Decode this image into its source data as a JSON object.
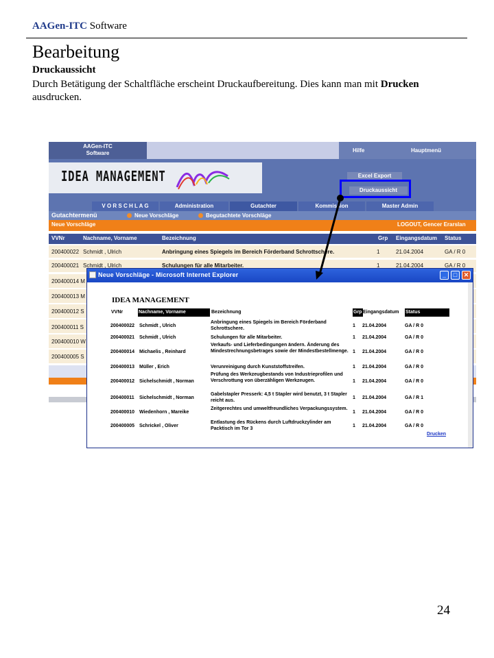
{
  "doc": {
    "header_brand": "AAGen-ITC",
    "header_rest": " Software",
    "title": "Bearbeitung",
    "subtitle": "Druckaussicht",
    "text_part1": "Durch Betätigung der Schaltfläche erscheint Druckaufbereitung. Dies kann man mit ",
    "text_bold": "Drucken",
    "text_part2": " ausdrucken.",
    "page_number": "24"
  },
  "app": {
    "logo_line1": "AAGen-ITC",
    "logo_line2": "Software",
    "help": "Hilfe",
    "main_menu": "Hauptmenü",
    "idea_logo": "IDEA MANAGEMENT",
    "excel_export": "Excel Export",
    "print_preview": "Druckaussicht",
    "nav": [
      "V O R S C H L A G",
      "Administration",
      "Gutachter",
      "Kommission",
      "Master Admin"
    ],
    "subnav_title": "Gutachtermenü",
    "subnav_links": [
      "Neue Vorschläge",
      "Begutachtete Vorschläge"
    ],
    "section_title": "Neue Vorschläge",
    "logout": "LOGOUT, Gencer Erarslan",
    "columns": [
      "VVNr",
      "Nachname, Vorname",
      "Bezeichnung",
      "Grp",
      "Eingangsdatum",
      "Status"
    ],
    "rows": [
      {
        "vvnr": "200400022",
        "name": "Schmidt , Ulrich",
        "desc": "Anbringung eines Spiegels im Bereich Förderband Schrottschere.",
        "grp": "1",
        "date": "21.04.2004",
        "status": "GA / R 0"
      },
      {
        "vvnr": "200400021",
        "name": "Schmidt , Ulrich",
        "desc": "Schulungen für alle Mitarbeiter.",
        "grp": "1",
        "date": "21.04.2004",
        "status": "GA / R 0"
      }
    ],
    "partial_rows": [
      "200400014 M",
      "200400013 M",
      "200400012 S",
      "200400011 S",
      "200400010 W",
      "200400005 S"
    ]
  },
  "popup": {
    "title": "Neue Vorschläge - Microsoft Internet Explorer",
    "heading": "IDEA MANAGEMENT",
    "columns": [
      "VVNr",
      "Nachname, Vorname",
      "Bezeichnung",
      "Grp",
      "Eingangsdatum",
      "Status"
    ],
    "rows": [
      {
        "vvnr": "200400022",
        "name": "Schmidt , Ulrich",
        "desc": "Anbringung eines Spiegels im Bereich Förderband Schrottschere.",
        "grp": "1",
        "date": "21.04.2004",
        "status": "GA / R 0"
      },
      {
        "vvnr": "200400021",
        "name": "Schmidt , Ulrich",
        "desc": "Schulungen für alle Mitarbeiter.",
        "grp": "1",
        "date": "21.04.2004",
        "status": "GA / R 0"
      },
      {
        "vvnr": "200400014",
        "name": "Michaelis , Reinhard",
        "desc": "Verkaufs- und Lieferbedingungen ändern. Änderung des Mindestrechnungsbetrages sowie der Mindestbestellmenge.",
        "grp": "1",
        "date": "21.04.2004",
        "status": "GA / R 0"
      },
      {
        "vvnr": "200400013",
        "name": "Müller , Erich",
        "desc": "Verunreinigung durch Kunststoffstreifen.",
        "grp": "1",
        "date": "21.04.2004",
        "status": "GA / R 0"
      },
      {
        "vvnr": "200400012",
        "name": "Sichelschmidt , Norman",
        "desc": "Prüfung des Werkzeugbestands von Industrieprofilen und Verschrottung von überzähligen Werkzeugen.",
        "grp": "1",
        "date": "21.04.2004",
        "status": "GA / R 0"
      },
      {
        "vvnr": "200400011",
        "name": "Sichelschmidt , Norman",
        "desc": "Gabelstapler Presserk: 4,5 t Stapler wird benutzt, 3 t Stapler reicht aus.",
        "grp": "1",
        "date": "21.04.2004",
        "status": "GA / R 1"
      },
      {
        "vvnr": "200400010",
        "name": "Wiedenhorn , Mareike",
        "desc": "Zeitgerechtes und umweltfreundliches Verpackungssystem.",
        "grp": "1",
        "date": "21.04.2004",
        "status": "GA / R 0"
      },
      {
        "vvnr": "200400005",
        "name": "Schrickel , Oliver",
        "desc": "Entlastung des Rückens durch Luftdruckzylinder am Packtisch im Tor 3",
        "grp": "1",
        "date": "21.04.2004",
        "status": "GA / R 0"
      }
    ],
    "print_link": "Drucken"
  },
  "icons": {
    "minimize": "minimize-icon",
    "maximize": "maximize-icon",
    "close": "close-icon"
  },
  "colors": {
    "highlight": "#0000ff",
    "orange": "#f08018",
    "nav_blue": "#4d66ad"
  }
}
